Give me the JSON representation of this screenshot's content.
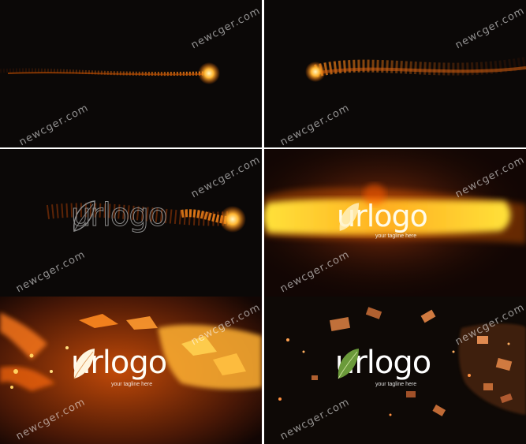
{
  "watermark": "newcger.com",
  "logo": {
    "text": "urlogo",
    "tagline": "your tagline here"
  },
  "colors": {
    "background": "#0b0807",
    "fire": "#ff8a1a",
    "glow": "#ffd24a",
    "leaf_green": "#6b9a3a"
  },
  "panels": [
    {
      "name": "frame-1-comet-right"
    },
    {
      "name": "frame-2-comet-left"
    },
    {
      "name": "frame-3-outline-logo"
    },
    {
      "name": "frame-4-glow-burst"
    },
    {
      "name": "frame-5-fire-logo"
    },
    {
      "name": "frame-6-final-logo"
    }
  ]
}
